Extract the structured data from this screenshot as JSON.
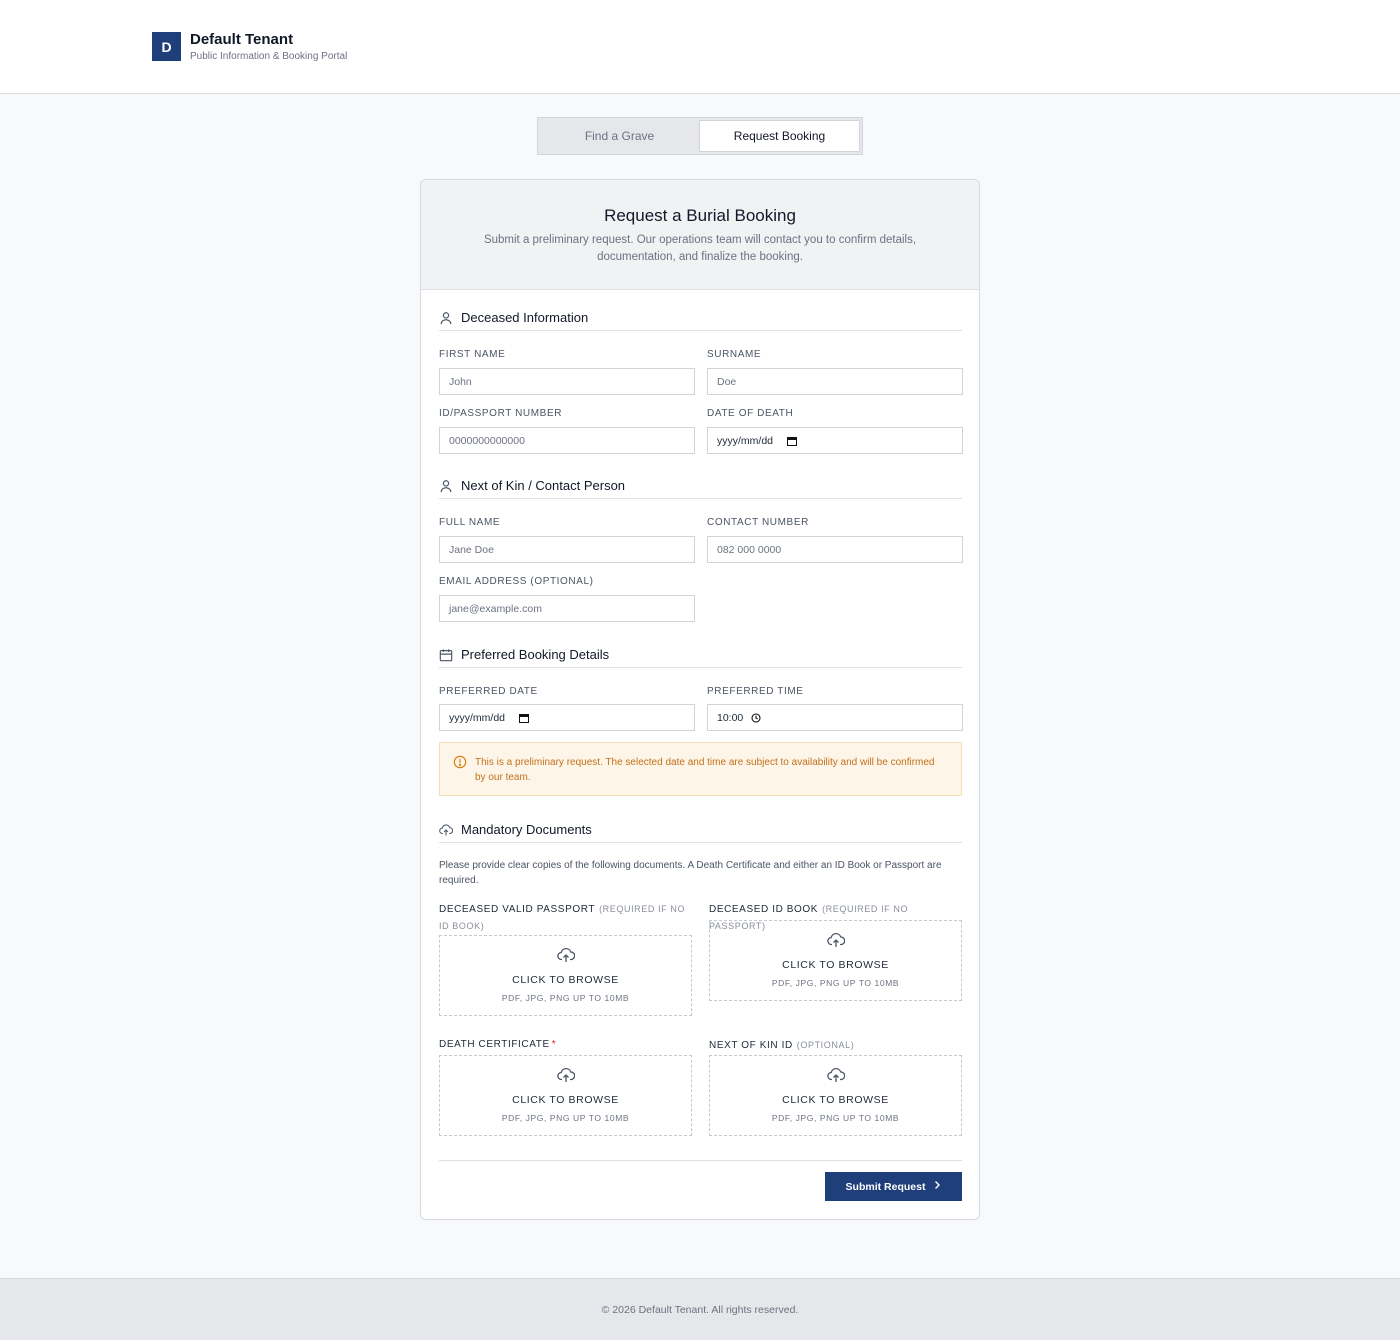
{
  "brand": {
    "logo_letter": "D",
    "title": "Default Tenant",
    "subtitle": "Public Information & Booking Portal"
  },
  "tabs": [
    {
      "label": "Find a Grave",
      "active": false
    },
    {
      "label": "Request Booking",
      "active": true
    }
  ],
  "form": {
    "title": "Request a Burial Booking",
    "description": "Submit a preliminary request. Our operations team will contact you to confirm details, documentation, and finalize the booking.",
    "sections": {
      "deceased": "Deceased Information",
      "kin": "Next of Kin / Contact Person",
      "booking": "Preferred Booking Details",
      "docs": "Mandatory Documents"
    },
    "fields": {
      "first_name": {
        "label": "FIRST NAME",
        "placeholder": "John"
      },
      "surname": {
        "label": "SURNAME",
        "placeholder": "Doe"
      },
      "id_number": {
        "label": "ID/PASSPORT NUMBER",
        "placeholder": "0000000000000"
      },
      "date_of_death": {
        "label": "DATE OF DEATH",
        "value": "yyyy/mm/dd"
      },
      "full_name": {
        "label": "FULL NAME",
        "placeholder": "Jane Doe"
      },
      "contact_number": {
        "label": "CONTACT NUMBER",
        "placeholder": "082 000 0000"
      },
      "email": {
        "label": "EMAIL ADDRESS (OPTIONAL)",
        "placeholder": "jane@example.com"
      },
      "preferred_date": {
        "label": "PREFERRED DATE",
        "value": "yyyy/mm/dd"
      },
      "preferred_time": {
        "label": "PREFERRED TIME",
        "value": "10:00"
      }
    },
    "notice": "This is a preliminary request. The selected date and time are subject to availability and will be confirmed by our team.",
    "docs_description": "Please provide clear copies of the following documents. A Death Certificate and either an ID Book or Passport are required.",
    "uploads": [
      {
        "label": "DECEASED VALID PASSPORT",
        "note": "(REQUIRED IF NO ID BOOK)",
        "required": false
      },
      {
        "label": "DECEASED ID BOOK",
        "note": "(REQUIRED IF NO PASSPORT)",
        "required": false
      },
      {
        "label": "DEATH CERTIFICATE",
        "note": "",
        "required": true,
        "required_mark": "*"
      },
      {
        "label": "NEXT OF KIN ID",
        "note": "(OPTIONAL)",
        "required": false
      }
    ],
    "dropzone_title": "CLICK TO BROWSE",
    "dropzone_hint": "PDF, JPG, PNG UP TO 10MB",
    "submit_label": "Submit Request"
  },
  "footer": {
    "text": "© 2026 Default Tenant. All rights reserved."
  },
  "colors": {
    "brand": "#1e3f7a",
    "warning": "#c2701c",
    "required": "#dc2626"
  },
  "icons": {
    "deceased_section": "user-icon",
    "kin_section": "user-icon",
    "booking_section": "calendar-icon",
    "docs_section": "cloud-upload-icon",
    "notice": "alert-circle-icon",
    "submit": "chevron-right-icon"
  }
}
